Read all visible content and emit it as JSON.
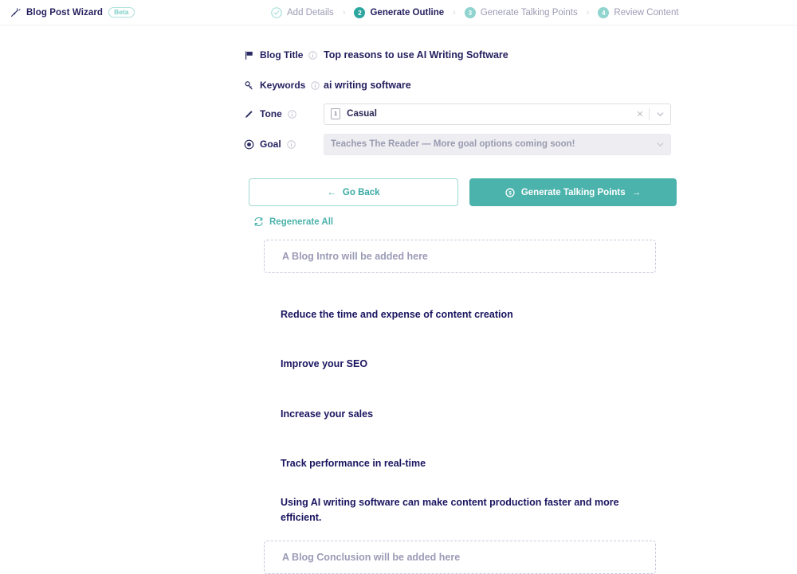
{
  "header": {
    "brand_icon": "magic-wand-icon",
    "brand": "Blog Post Wizard",
    "beta_badge": "Beta",
    "steps": [
      {
        "num": "",
        "label": "Add Details",
        "state": "done",
        "icon": "check-circle-icon"
      },
      {
        "num": "2",
        "label": "Generate Outline",
        "state": "active"
      },
      {
        "num": "3",
        "label": "Generate Talking Points",
        "state": "todo"
      },
      {
        "num": "4",
        "label": "Review Content",
        "state": "todo"
      }
    ],
    "separator": "›"
  },
  "form": {
    "blog_title": {
      "label": "Blog Title",
      "icon": "flag-icon",
      "info_icon": "info-circle-icon",
      "value": "Top reasons to use AI Writing Software"
    },
    "keywords": {
      "label": "Keywords",
      "icon": "key-icon",
      "info_icon": "info-circle-icon",
      "value": "ai writing software"
    },
    "tone": {
      "label": "Tone",
      "icon": "pencil-icon",
      "info_icon": "info-circle-icon",
      "chip": "1",
      "value": "Casual",
      "clear_icon": "close-x-icon",
      "chevron_icon": "chevron-down-icon"
    },
    "goal": {
      "label": "Goal",
      "icon": "target-icon",
      "info_icon": "info-circle-icon",
      "placeholder": "Teaches The Reader — More goal options coming soon!",
      "chevron_icon": "chevron-down-icon",
      "disabled": true
    }
  },
  "actions": {
    "back": {
      "label": "Go Back",
      "arrow": "←",
      "icon": "arrow-left-icon"
    },
    "next": {
      "label": "Generate Talking Points",
      "arrow": "→",
      "icon": "credit-coin-icon"
    },
    "regenerate": {
      "label": "Regenerate All",
      "icon": "refresh-icon"
    }
  },
  "outline": {
    "intro_placeholder": "A Blog Intro will be added here",
    "conclusion_placeholder": "A Blog Conclusion will be added here",
    "items": [
      "Reduce the time and expense of content creation",
      "Improve your SEO",
      "Increase your sales",
      "Track performance in real-time",
      "Using AI writing software can make content production faster and more efficient."
    ]
  },
  "colors": {
    "accent": "#4cb3ac",
    "accent_dark": "#2ea6a0",
    "accent_light": "#8fd4cf",
    "text": "#241f5e",
    "muted": "#9b9ab6",
    "field_grey": "#eeeef2"
  }
}
